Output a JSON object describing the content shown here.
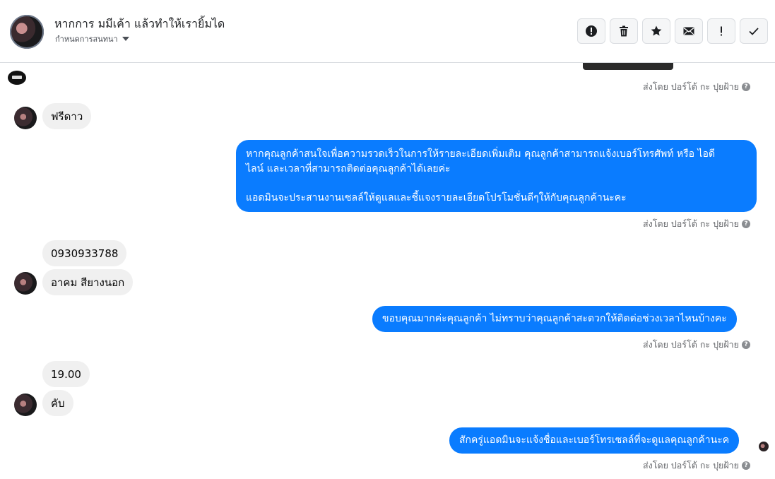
{
  "header": {
    "title": "หากการ มมีเค้า แล้วทำให้เรายิ้มได",
    "subtitle": "กำหนดการสนทนา",
    "actions": [
      {
        "name": "report-button",
        "icon": "alert-circle-icon"
      },
      {
        "name": "delete-button",
        "icon": "trash-icon"
      },
      {
        "name": "star-button",
        "icon": "star-icon"
      },
      {
        "name": "mail-button",
        "icon": "envelope-icon"
      },
      {
        "name": "mark-important-button",
        "icon": "exclamation-icon"
      },
      {
        "name": "mark-done-button",
        "icon": "check-icon"
      }
    ]
  },
  "sender_label": "ส่งโดย ปอร์โต้ กะ ปุยฝ้าย",
  "messages": {
    "m1": "ฟรีดาว",
    "m2_line1": "หากคุณลูกค้าสนใจเพื่อความรวดเร็วในการให้รายละเอียดเพิ่มเติม คุณลูกค้าสามารถแจ้งเบอร์โทรศัพท์ หรือ ไอดี",
    "m2_line2": "ไลน์ และเวลาที่สามารถติดต่อคุณลูกค้าได้เลยค่ะ",
    "m2_line3": "แอดมินจะประสานงานเซลล์ให้ดูแลและชี้แจงรายละเอียดโปรโมชั่นดีๆให้กับคุณลูกค้านะคะ",
    "m3": "0930933788",
    "m4": "อาคม สียางนอก",
    "m5": "ขอบคุณมากค่ะคุณลูกค้า ไม่ทราบว่าคุณลูกค้าสะดวกให้ติดต่อช่วงเวลาไหนบ้างคะ",
    "m6": "19.00",
    "m7": "คับ",
    "m8": "สักครู่แอดมินจะแจ้งชื่อและเบอร์โทรเซลล์ที่จะดูแลคุณลูกค้านะค"
  },
  "colors": {
    "outgoing_bubble": "#0a7cff",
    "incoming_bubble": "#f0f0f0"
  }
}
